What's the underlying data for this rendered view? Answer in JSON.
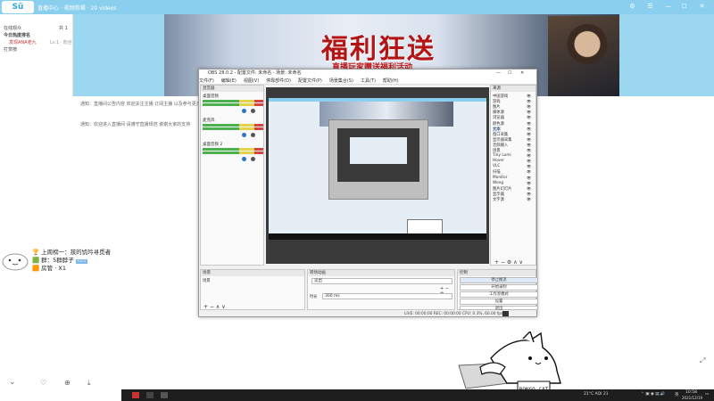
{
  "topbar": {
    "app_badge": "Sü",
    "title": "直播中心 · 视频剪辑 · 20 videos",
    "controls": [
      "⚙",
      "☰",
      "—",
      "☐",
      "✕"
    ]
  },
  "left_panel": {
    "row1": "在线观众",
    "row1_right": "共 1",
    "section": "今日热度排名",
    "user_line": "发现ANA老九",
    "user_meta": "Lv.1 · 粉丝",
    "bottom": "打赏榜"
  },
  "banner": {
    "headline": "福利狂送",
    "sub": "直播玩家赠送福利活动"
  },
  "notices": [
    "通知：直播间公告内容 欢迎关注主播 订阅主播 以及参与更多互动活动 请文明发言",
    "通知：欢迎进入直播间 请遵守直播规范 谢谢大家的支持"
  ],
  "obs": {
    "title": "OBS 28.0.2 - 配置文件: 未命名 - 场景: 未命名",
    "menu": [
      "文件(F)",
      "编辑(E)",
      "视图(V)",
      "停靠部件(D)",
      "配置文件(P)",
      "场景集合(S)",
      "工具(T)",
      "帮助(H)"
    ],
    "audio_title": "混音器",
    "audio_channels": [
      {
        "label": "桌面音频",
        "level": 0.62
      },
      {
        "label": "麦克风",
        "level": 0.55
      },
      {
        "label": "桌面音频 2",
        "level": 0.58
      }
    ],
    "sources_title": "来源",
    "sources": [
      "中国游戏",
      "游戏",
      "图片",
      "媒体源",
      "浏览器",
      "颜色源",
      "文本",
      "窗口采集",
      "显示器采集",
      "音频输入",
      "场景",
      "Tiny Lumi",
      "Hover",
      "VLC",
      "扫描",
      "Monitor",
      "Wong",
      "图片幻灯片",
      "显示器",
      "文字源"
    ],
    "scenes_title": "场景",
    "scenes": [
      "场景"
    ],
    "transitions_title": "转场动画",
    "transition_value": "淡出",
    "duration_label": "时长",
    "duration_value": "300 ms",
    "controls_title": "控制",
    "controls": [
      "停止推流",
      "开始录制",
      "工作室模式",
      "设置",
      "退出"
    ],
    "status": "LIVE: 00:00:00    REC: 00:00:00    CPU: 0.3%, 60.00 fps"
  },
  "chat": {
    "lines": [
      "上周榜一：孩的饥吟寻觅者",
      "群：5群脖子",
      "房管 · X1"
    ],
    "badge": "Lv.5"
  },
  "bongo": {
    "plate": "BONGO CAT"
  },
  "taskbar": {
    "weather": "21°C  AQI 21",
    "time": "10:58",
    "date": "2021/12/19",
    "ime": "英"
  }
}
